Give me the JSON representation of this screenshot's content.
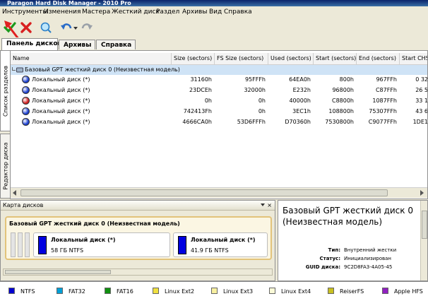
{
  "window": {
    "title": "Paragon Hard Disk Manager - 2010 Pro"
  },
  "menu": [
    "Инструменты",
    "Изменения",
    "Мастера",
    "Жесткий диск",
    "Раздел",
    "Архивы",
    "Вид",
    "Справка"
  ],
  "toolbar": {
    "apply_icon": "check-icon",
    "discard_icon": "x-icon",
    "search_icon": "magnifier-icon",
    "undo_icon": "undo-icon",
    "redo_icon": "redo-icon"
  },
  "tabs": [
    "Панель дисков",
    "Архивы",
    "Справка"
  ],
  "side_tabs": [
    "Список разделов",
    "Редактор диска"
  ],
  "table": {
    "columns": [
      "Name",
      "Size (sectors)",
      "FS Size (sectors)",
      "Used (sectors)",
      "Start (sectors)",
      "End (sectors)",
      "Start CHS(c"
    ],
    "disk_row": "Базовый GPT жесткий диск 0 (Неизвестная модель)",
    "rows": [
      {
        "name": "Локальный диск (*)",
        "size": "31160h",
        "fs_size": "95FFFh",
        "used": "64EA0h",
        "start": "800h",
        "end": "967FFh",
        "chs": "0 32",
        "color": "#1a3fd0"
      },
      {
        "name": "Локальный диск (*)",
        "size": "23DCEh",
        "fs_size": "32000h",
        "used": "E232h",
        "start": "96800h",
        "end": "C87FFh",
        "chs": "26 5",
        "color": "#1a3fd0"
      },
      {
        "name": "Локальный диск (*)",
        "size": "0h",
        "fs_size": "0h",
        "used": "40000h",
        "start": "C8800h",
        "end": "1087FFh",
        "chs": "33 1",
        "color": "#d02020"
      },
      {
        "name": "Локальный диск (*)",
        "size": "742413Fh",
        "fs_size": "0h",
        "used": "3EC1h",
        "start": "108800h",
        "end": "75307FFh",
        "chs": "43 6",
        "color": "#1a3fd0"
      },
      {
        "name": "Локальный диск (*)",
        "size": "4666CA0h",
        "fs_size": "53D6FFFh",
        "used": "D70360h",
        "start": "7530800h",
        "end": "C9077FFh",
        "chs": "1DE1",
        "color": "#1a3fd0"
      }
    ]
  },
  "disk_map": {
    "title": "Карта дисков",
    "disk_label": "Базовый GPT жесткий диск 0 (Неизвестная модель)",
    "partitions": [
      {
        "name": "Локальный диск (*)",
        "info": "58 ГБ NTFS"
      },
      {
        "name": "Локальный диск (*)",
        "info": "41.9 ГБ NTFS"
      }
    ]
  },
  "info_panel": {
    "title": "Базовый GPT жесткий диск 0 (Неизвестная модель)",
    "fields": [
      {
        "label": "Тип:",
        "value": "Внутренний жестки"
      },
      {
        "label": "Статус:",
        "value": "Инициализирован"
      },
      {
        "label": "GUID диска:",
        "value": "9C2D8FA3-4A05-45"
      }
    ]
  },
  "legend": [
    {
      "label": "NTFS",
      "color": "#0000d0"
    },
    {
      "label": "FAT32",
      "color": "#00a0d8"
    },
    {
      "label": "FAT16",
      "color": "#109010"
    },
    {
      "label": "Linux Ext2",
      "color": "#f0e040"
    },
    {
      "label": "Linux Ext3",
      "color": "#f8f0a0"
    },
    {
      "label": "Linux Ext4",
      "color": "#fafad8"
    },
    {
      "label": "ReiserFS",
      "color": "#c8c020"
    },
    {
      "label": "Apple HFS",
      "color": "#9020c0"
    }
  ]
}
